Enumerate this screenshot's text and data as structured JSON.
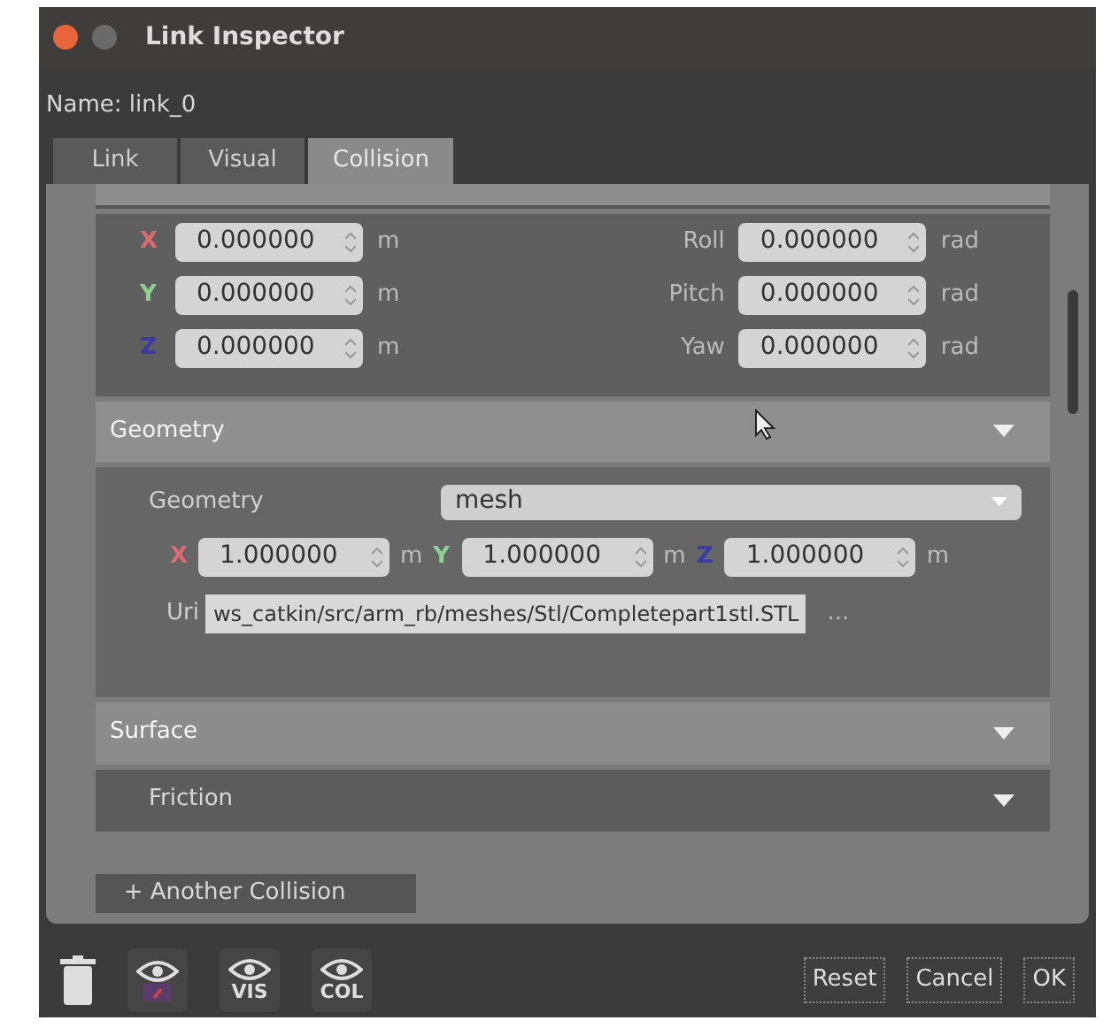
{
  "window": {
    "title": "Link Inspector"
  },
  "name_label": "Name: link_0",
  "tabs": [
    {
      "label": "Link",
      "selected": false
    },
    {
      "label": "Visual",
      "selected": false
    },
    {
      "label": "Collision",
      "selected": true
    }
  ],
  "pose": {
    "position": [
      {
        "axis": "X",
        "color": "#e06a70",
        "value": "0.000000",
        "unit": "m"
      },
      {
        "axis": "Y",
        "color": "#8ed092",
        "value": "0.000000",
        "unit": "m"
      },
      {
        "axis": "Z",
        "color": "#3a3aa8",
        "value": "0.000000",
        "unit": "m"
      }
    ],
    "rotation": [
      {
        "label": "Roll",
        "value": "0.000000",
        "unit": "rad"
      },
      {
        "label": "Pitch",
        "value": "0.000000",
        "unit": "rad"
      },
      {
        "label": "Yaw",
        "value": "0.000000",
        "unit": "rad"
      }
    ]
  },
  "geometry_section": {
    "header": "Geometry",
    "type_label": "Geometry",
    "type_value": "mesh",
    "scale": [
      {
        "axis": "X",
        "color": "#e06a70",
        "value": "1.000000",
        "unit": "m"
      },
      {
        "axis": "Y",
        "color": "#8ed092",
        "value": "1.000000",
        "unit": "m"
      },
      {
        "axis": "Z",
        "color": "#3a3aa8",
        "value": "1.000000",
        "unit": "m"
      }
    ],
    "uri_label": "Uri",
    "uri_value": "ws_catkin/src/arm_rb/meshes/Stl/Completepart1stl.STL",
    "browse": "..."
  },
  "sections": [
    {
      "header": "Surface",
      "highlighted": true
    },
    {
      "header": "Friction",
      "highlighted": false
    }
  ],
  "add_button": "+ Another Collision",
  "view_buttons": [
    {
      "kind": "color"
    },
    {
      "kind": "text",
      "label": "VIS"
    },
    {
      "kind": "text",
      "label": "COL"
    }
  ],
  "buttons": [
    "Reset",
    "Cancel",
    "OK"
  ]
}
